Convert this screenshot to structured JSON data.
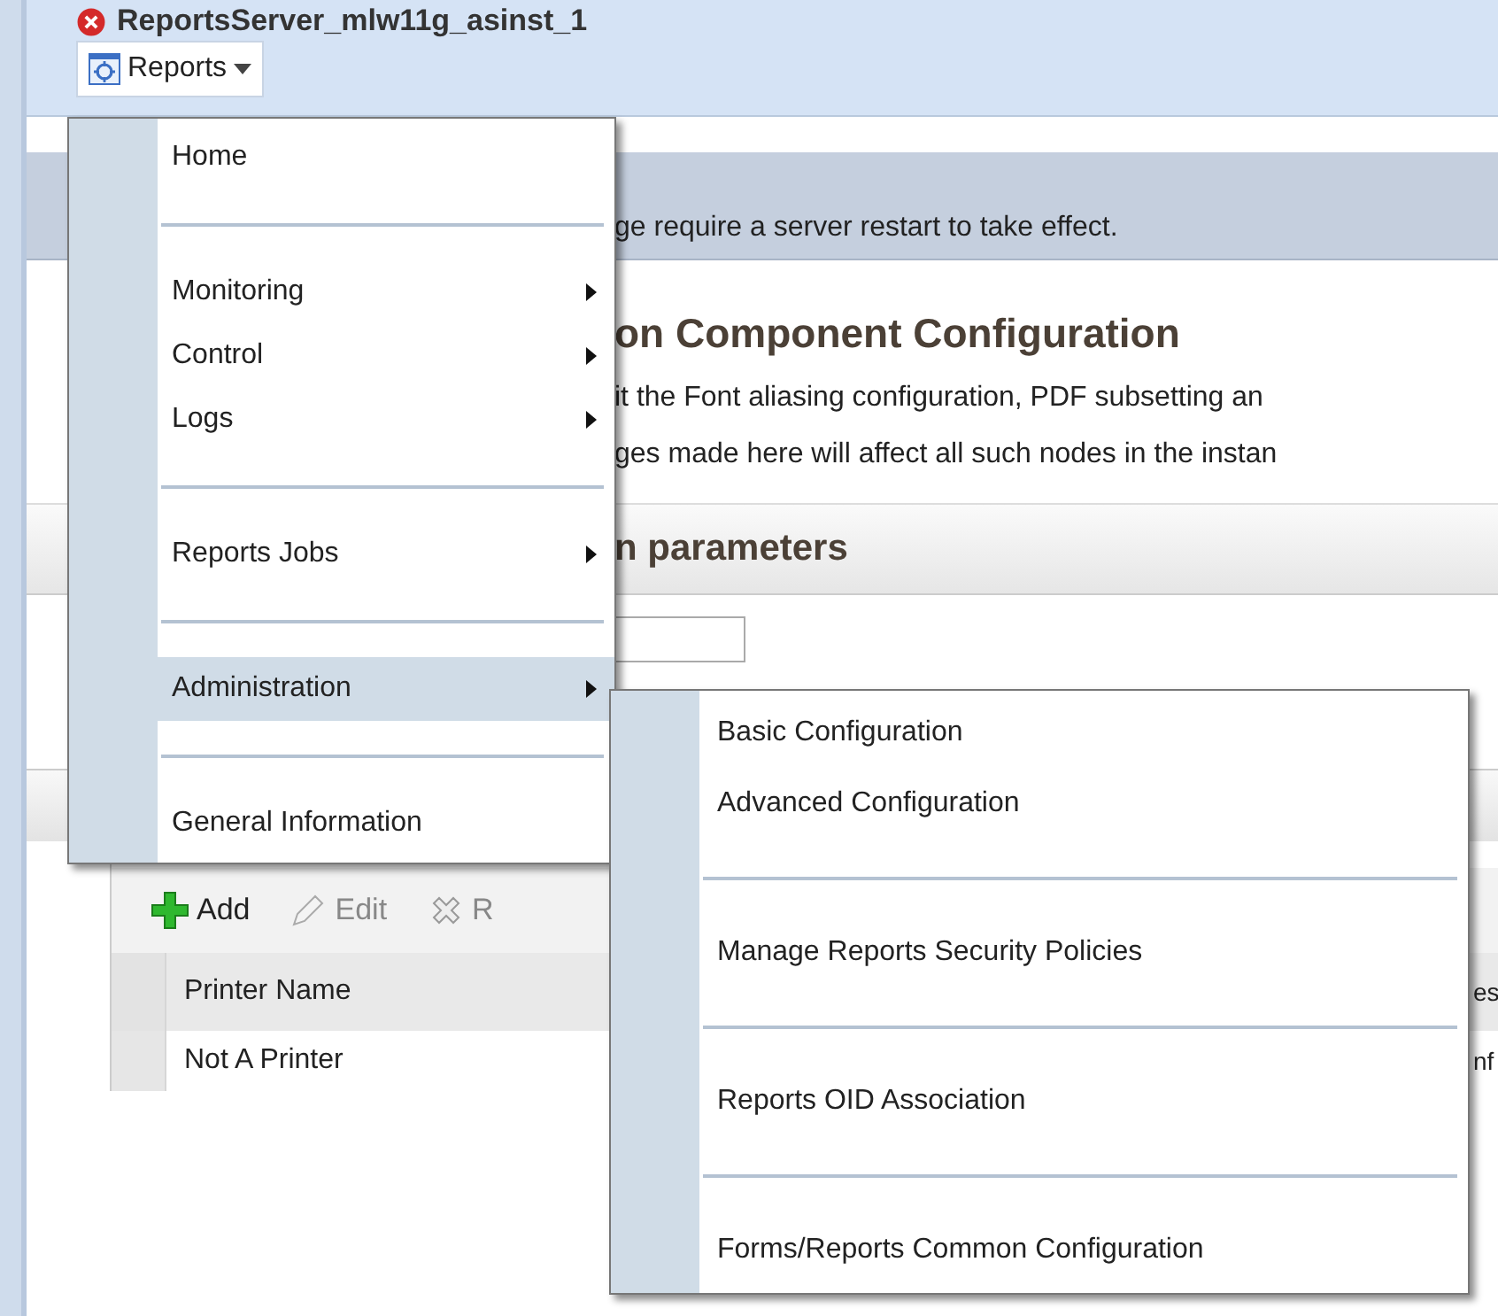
{
  "header": {
    "title": "ReportsServer_mlw11g_asinst_1",
    "menu_button": "Reports"
  },
  "message": "ge require a server restart to take effect.",
  "heading": "on Component Configuration",
  "description": [
    "it the Font aliasing configuration, PDF subsetting an",
    "ges made here will affect all such nodes in the instan"
  ],
  "section_title": "n parameters",
  "toolbar": [
    {
      "label": "Add",
      "kind": "add",
      "disabled": false
    },
    {
      "label": "Edit",
      "kind": "edit",
      "disabled": true
    },
    {
      "label": "R",
      "kind": "remove",
      "disabled": true
    }
  ],
  "table": {
    "columns": [
      "Printer Name",
      "es"
    ],
    "rows": [
      [
        "Not A Printer",
        "nf"
      ]
    ]
  },
  "menu": [
    {
      "kind": "item",
      "label": "Home",
      "submenu": false,
      "selected": false
    },
    {
      "kind": "separator"
    },
    {
      "kind": "item",
      "label": "Monitoring",
      "submenu": true,
      "selected": false
    },
    {
      "kind": "item",
      "label": "Control",
      "submenu": true,
      "selected": false
    },
    {
      "kind": "item",
      "label": "Logs",
      "submenu": true,
      "selected": false
    },
    {
      "kind": "separator"
    },
    {
      "kind": "item",
      "label": "Reports Jobs",
      "submenu": true,
      "selected": false
    },
    {
      "kind": "separator"
    },
    {
      "kind": "item",
      "label": "Administration",
      "submenu": true,
      "selected": true
    },
    {
      "kind": "separator"
    },
    {
      "kind": "item",
      "label": "General Information",
      "submenu": false,
      "selected": false
    }
  ],
  "submenu": [
    {
      "kind": "item",
      "label": "Basic Configuration",
      "submenu": false,
      "selected": false
    },
    {
      "kind": "item",
      "label": "Advanced Configuration",
      "submenu": false,
      "selected": false
    },
    {
      "kind": "separator"
    },
    {
      "kind": "item",
      "label": "Manage Reports Security Policies",
      "submenu": false,
      "selected": false
    },
    {
      "kind": "separator"
    },
    {
      "kind": "item",
      "label": "Reports OID Association",
      "submenu": false,
      "selected": false
    },
    {
      "kind": "separator"
    },
    {
      "kind": "item",
      "label": "Forms/Reports Common Configuration",
      "submenu": false,
      "selected": false
    }
  ]
}
